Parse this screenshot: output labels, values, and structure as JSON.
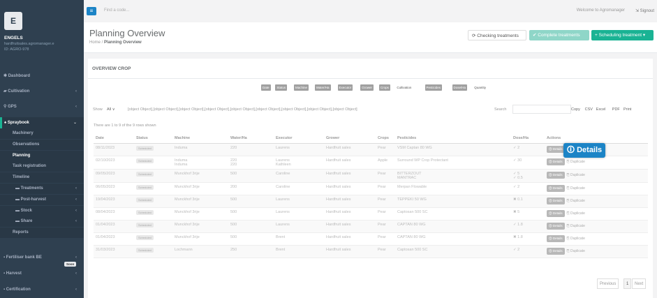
{
  "sidebar": {
    "logo": "E",
    "brand": "ENGELS",
    "user": "hardfruitsales.agromanager.e",
    "id": "ID: AGRO-978",
    "nav": [
      {
        "label": "Dashboard",
        "icon": "✱"
      },
      {
        "label": "Cultivation",
        "icon": "▰"
      },
      {
        "label": "GPS",
        "icon": "⚲"
      },
      {
        "label": "Spraybook",
        "icon": "♠"
      }
    ],
    "sub": [
      "Machinery",
      "Observations",
      "Planning",
      "Task registration",
      "Timeline",
      "Treatments",
      "Post-harvest",
      "Stock",
      "Share",
      "Reports"
    ],
    "lower": [
      "Fertiliser bank BE",
      "Harvest",
      "Certification"
    ],
    "soon": "Soon"
  },
  "top": {
    "search": "Find a code...",
    "welcome": "Welcome to Agromanager",
    "signout": "Signout"
  },
  "header": {
    "title": "Planning Overview",
    "crumb_home": "Home",
    "crumb_current": "Planning Overview",
    "check": "Checking treatments",
    "complete": "✔ Complete treatments",
    "schedule": "+ Scheduling treatment ▾"
  },
  "panel": {
    "title": "OVERVIEW CROP",
    "cols": [
      "Date",
      "Status",
      "Machine",
      "Water/Ha",
      "Executor",
      "Grower",
      "Crops",
      "Cultivation",
      "Pesticides",
      "Dose/Ha",
      "Quantity"
    ],
    "show": "Show",
    "all": "All",
    "rows": [
      {
        "date": "08/11/2023",
        "status": "Scheduled",
        "machine": "Induma",
        "water": "220",
        "executor": "Laurens",
        "grower": "Hardfruit sales",
        "crop": "Pear",
        "pest": "VSM Captan 80 WG",
        "dose": "✓ 2"
      },
      {
        "date": "02/10/2023",
        "status": "Scheduled",
        "machine": "Induma\nInduma",
        "water": "220\n220",
        "executor": "Laurens\nKathleen",
        "grower": "Hardfruit sales",
        "crop": "Apple",
        "pest": "Surround WP Crop Protectant",
        "dose": "✓ 30"
      },
      {
        "date": "09/05/2023",
        "status": "Scheduled",
        "machine": "Munckhof 3rije",
        "water": "500",
        "executor": "Caroline",
        "grower": "Hardfruit sales",
        "crop": "Pear",
        "pest": "BITTERZOUT\nMANTRAC",
        "dose": "✓ 5\n✓ 0.5"
      },
      {
        "date": "06/05/2023",
        "status": "Scheduled",
        "machine": "Munckhof 3rije",
        "water": "200",
        "executor": "Caroline",
        "grower": "Hardfruit sales",
        "crop": "Pear",
        "pest": "Merpan Flowable",
        "dose": "✓ 2"
      },
      {
        "date": "19/04/2023",
        "status": "Scheduled",
        "machine": "Munckhof 3rije",
        "water": "500",
        "executor": "Laurens",
        "grower": "Hardfruit sales",
        "crop": "Pear",
        "pest": "TEPPEKI 50 WG",
        "dose": "✖ 0.1"
      },
      {
        "date": "08/04/2023",
        "status": "Scheduled",
        "machine": "Munckhof 3rije",
        "water": "500",
        "executor": "Laurens",
        "grower": "Hardfruit sales",
        "crop": "Pear",
        "pest": "Captosan 500 SC",
        "dose": "✖ 5"
      },
      {
        "date": "01/04/2023",
        "status": "Scheduled",
        "machine": "Munckhof 3rije",
        "water": "500",
        "executor": "Laurens",
        "grower": "Hardfruit sales",
        "crop": "Pear",
        "pest": "CAPTAN 80 WG",
        "dose": "✓ 1.8"
      },
      {
        "date": "01/04/2023",
        "status": "Scheduled",
        "machine": "Munckhof 3rije",
        "water": "500",
        "executor": "Brent",
        "grower": "Hardfruit sales",
        "crop": "Pear",
        "pest": "CAPTAN 80 WG",
        "dose": "✖ 1.8"
      },
      {
        "date": "31/03/2023",
        "status": "Scheduled",
        "machine": "Lochmann",
        "water": "250",
        "executor": "Brent",
        "grower": "Hardfruit sales",
        "crop": "Pear",
        "pest": "Captosan 500 SC",
        "dose": "✓ 2"
      }
    ],
    "search_label": "Search",
    "exports": [
      "Copy",
      "CSV",
      "Excel",
      "PDF",
      "Print"
    ],
    "info": "There are 1 to 9 of the 9 rows shown",
    "headers": [
      "Date",
      "Status",
      "Machine",
      "Water/Ha",
      "Executor",
      "Grower",
      "Crops",
      "Pesticides",
      "Dose/Ha",
      "Actions"
    ],
    "details": "Details",
    "duplicate": "Duplicate",
    "callout": "Details",
    "prev": "Previous",
    "page": "1",
    "next": "Next"
  },
  "colors": {
    "sidebar": "#2f4050",
    "accent": "#1ab394",
    "primary": "#1c84c6"
  }
}
